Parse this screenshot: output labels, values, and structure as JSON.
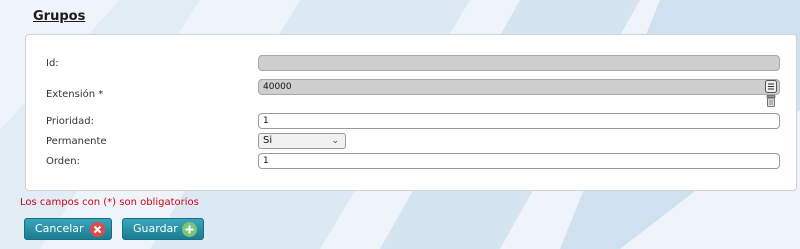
{
  "page": {
    "title": "Grupos"
  },
  "form": {
    "id": {
      "label": "Id:",
      "value": ""
    },
    "extension": {
      "label": "Extensión *",
      "value": "40000"
    },
    "prioridad": {
      "label": "Prioridad:",
      "value": "1"
    },
    "permanente": {
      "label": "Permanente",
      "selected": "Si"
    },
    "orden": {
      "label": "Orden:",
      "value": "1"
    }
  },
  "note": "Los campos con (*) son obligatorios",
  "buttons": {
    "cancel": "Cancelar",
    "save": "Guardar"
  },
  "icons": {
    "extension_list": "list-icon",
    "extension_delete": "trash-icon",
    "cancel": "close-circle-icon",
    "save": "add-circle-icon",
    "select": "chevron-down-icon"
  },
  "colors": {
    "button": "#2592a6",
    "note": "#d0021b",
    "cancel_icon": "#e04a4a",
    "save_icon": "#7cc47a"
  }
}
